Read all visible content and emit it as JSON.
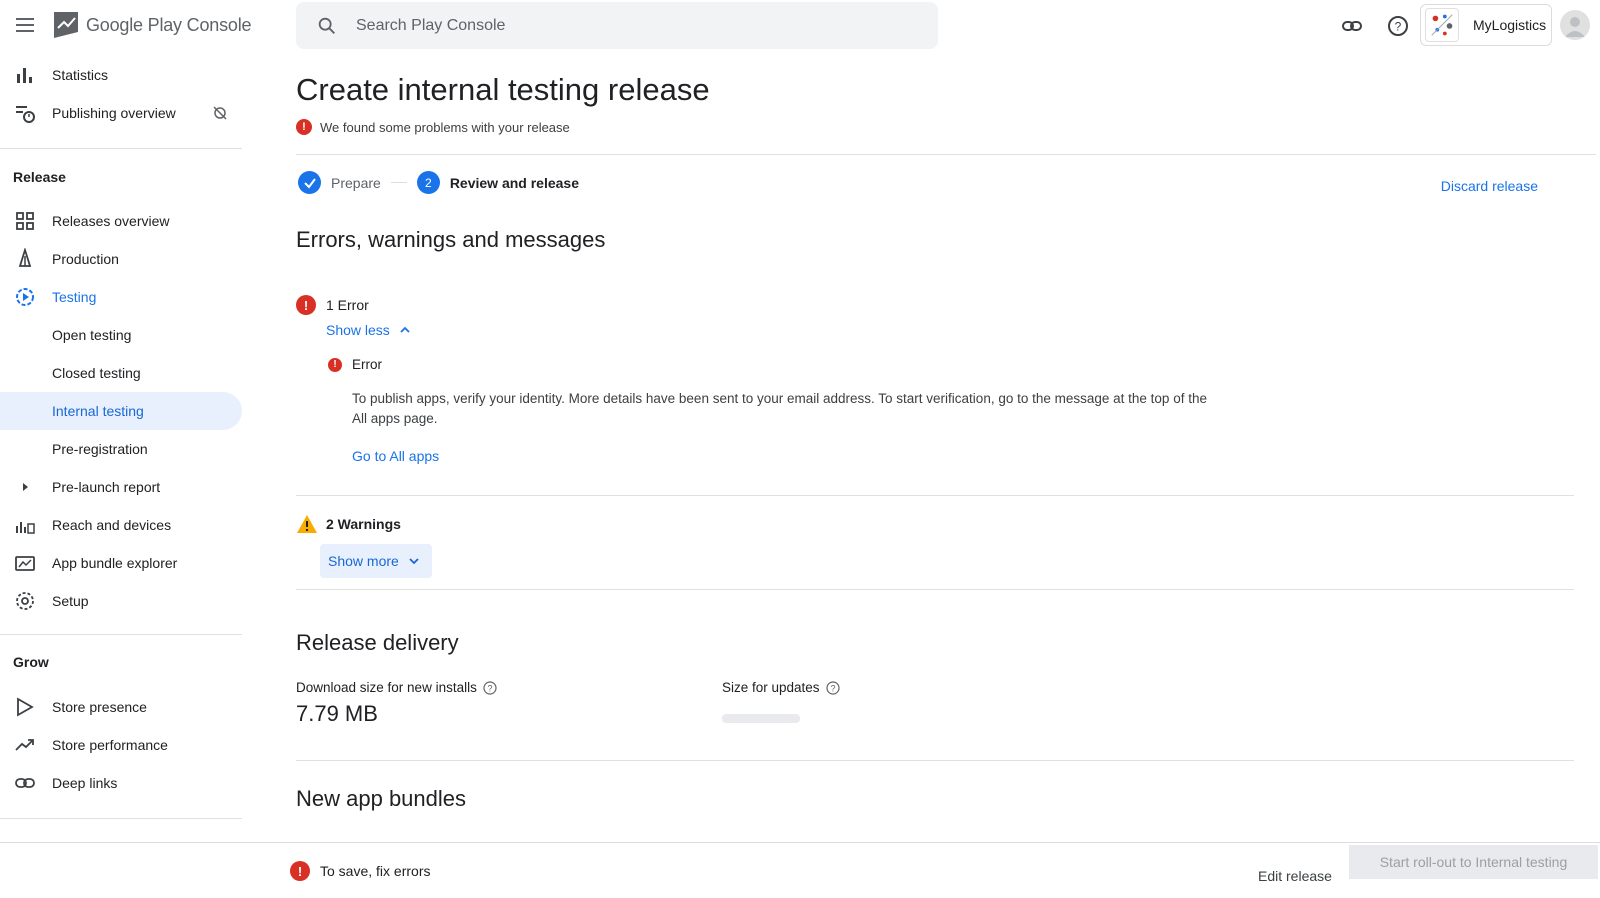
{
  "header": {
    "brand": "Google Play Console",
    "search_placeholder": "Search Play Console",
    "account_name": "MyLogistics"
  },
  "sidebar": {
    "top_items": [
      {
        "label": "Statistics",
        "icon": "bar-chart-icon"
      },
      {
        "label": "Publishing overview",
        "icon": "publishing-overview-icon"
      }
    ],
    "release_title": "Release",
    "release_items": [
      {
        "label": "Releases overview",
        "icon": "dashboard-icon"
      },
      {
        "label": "Production",
        "icon": "rocket-icon"
      },
      {
        "label": "Testing",
        "icon": "testing-icon"
      },
      {
        "label": "Open testing"
      },
      {
        "label": "Closed testing"
      },
      {
        "label": "Internal testing"
      },
      {
        "label": "Pre-registration"
      },
      {
        "label": "Pre-launch report",
        "icon": "expand-arrow-icon"
      },
      {
        "label": "Reach and devices",
        "icon": "reach-icon"
      },
      {
        "label": "App bundle explorer",
        "icon": "bundle-icon"
      },
      {
        "label": "Setup",
        "icon": "gear-icon"
      }
    ],
    "grow_title": "Grow",
    "grow_items": [
      {
        "label": "Store presence",
        "icon": "play-outline-icon"
      },
      {
        "label": "Store performance",
        "icon": "trending-icon"
      },
      {
        "label": "Deep links",
        "icon": "link-icon"
      }
    ]
  },
  "main": {
    "title": "Create internal testing release",
    "problem_notice": "We found some problems with your release",
    "steps": [
      {
        "label": "Prepare",
        "state": "done"
      },
      {
        "label": "Review and release",
        "number": "2",
        "state": "current"
      }
    ],
    "discard_label": "Discard release",
    "errors_section_title": "Errors, warnings and messages",
    "error_group_title": "1 Error",
    "show_less_label": "Show less",
    "error_item_title": "Error",
    "error_item_body": "To publish apps, verify your identity. More details have been sent to your email address. To start verification, go to the message at the top of the All apps page.",
    "error_item_link": "Go to All apps",
    "warning_group_title": "2 Warnings",
    "show_more_label": "Show more",
    "delivery_title": "Release delivery",
    "download_size_label": "Download size for new installs",
    "download_size_value": "7.79 MB",
    "update_size_label": "Size for updates",
    "bundles_title": "New app bundles"
  },
  "footer": {
    "message": "To save, fix errors",
    "edit_label": "Edit release",
    "start_label": "Start roll-out to Internal testing"
  },
  "colors": {
    "accent": "#1a73e8",
    "error": "#d93025",
    "warning": "#f9ab00",
    "selected_bg": "#e8f0fe"
  }
}
